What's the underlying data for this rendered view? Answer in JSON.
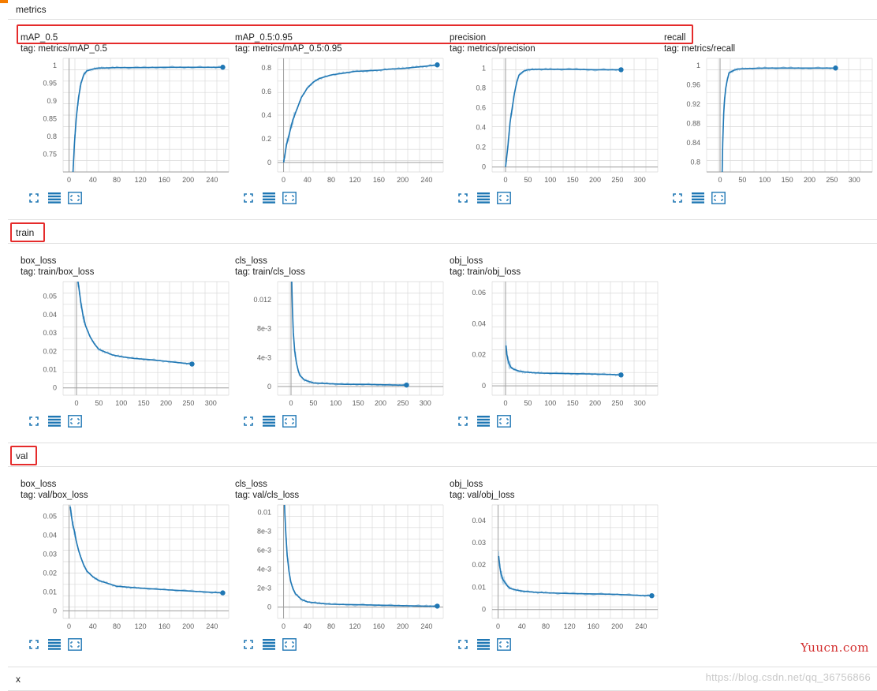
{
  "colors": {
    "topbar": "#f57c00",
    "line": "#1f77b4",
    "line_raw": "#b4d2e6",
    "highlight": "#e52b2b",
    "grid": "#d9d9d9"
  },
  "sections": [
    {
      "id": "metrics",
      "title": "metrics",
      "charts": [
        {
          "title": "mAP_0.5",
          "tag": "tag: metrics/mAP_0.5",
          "chart_data": {
            "type": "line",
            "title": "mAP_0.5",
            "xlim": [
              -10,
              268
            ],
            "ylim": [
              0.7,
              1.02
            ],
            "xticks": [
              0,
              40,
              80,
              120,
              160,
              200,
              240
            ],
            "yticks": [
              0.75,
              0.8,
              0.85,
              0.9,
              0.95,
              1
            ],
            "ytick_labels": [
              "0.75",
              "0.8",
              "0.85",
              "0.9",
              "0.95",
              "1"
            ],
            "series": [
              {
                "x": [
                  6,
                  9,
                  12,
                  16,
                  20,
                  25,
                  30,
                  40,
                  50,
                  60,
                  80,
                  120,
                  160,
                  200,
                  240,
                  258
                ],
                "y": [
                  0.68,
                  0.78,
                  0.85,
                  0.91,
                  0.95,
                  0.975,
                  0.985,
                  0.99,
                  0.993,
                  0.993,
                  0.994,
                  0.994,
                  0.995,
                  0.995,
                  0.995,
                  0.995
                ]
              }
            ]
          }
        },
        {
          "title": "mAP_0.5:0.95",
          "tag": "tag: metrics/mAP_0.5:0.95",
          "chart_data": {
            "type": "line",
            "title": "mAP_0.5:0.95",
            "xlim": [
              -10,
              268
            ],
            "ylim": [
              -0.08,
              0.88
            ],
            "xticks": [
              0,
              40,
              80,
              120,
              160,
              200,
              240
            ],
            "yticks": [
              0,
              0.2,
              0.4,
              0.6,
              0.8
            ],
            "ytick_labels": [
              "0",
              "0.2",
              "0.4",
              "0.6",
              "0.8"
            ],
            "series": [
              {
                "x": [
                  0,
                  5,
                  10,
                  15,
                  20,
                  30,
                  40,
                  50,
                  60,
                  80,
                  100,
                  120,
                  140,
                  160,
                  180,
                  200,
                  220,
                  240,
                  258
                ],
                "y": [
                  0,
                  0.15,
                  0.25,
                  0.35,
                  0.42,
                  0.55,
                  0.63,
                  0.68,
                  0.71,
                  0.74,
                  0.755,
                  0.77,
                  0.775,
                  0.78,
                  0.79,
                  0.795,
                  0.805,
                  0.815,
                  0.825
                ]
              }
            ]
          }
        },
        {
          "title": "precision",
          "tag": "tag: metrics/precision",
          "chart_data": {
            "type": "line",
            "title": "precision",
            "xlim": [
              -30,
              340
            ],
            "ylim": [
              -0.05,
              1.1
            ],
            "xticks": [
              0,
              50,
              100,
              150,
              200,
              250,
              300
            ],
            "yticks": [
              0,
              0.2,
              0.4,
              0.6,
              0.8,
              1
            ],
            "ytick_labels": [
              "0",
              "0.2",
              "0.4",
              "0.6",
              "0.8",
              "1"
            ],
            "series": [
              {
                "x": [
                  0,
                  5,
                  10,
                  15,
                  20,
                  25,
                  30,
                  40,
                  50,
                  70,
                  100,
                  150,
                  200,
                  258
                ],
                "y": [
                  0,
                  0.2,
                  0.45,
                  0.6,
                  0.75,
                  0.86,
                  0.93,
                  0.97,
                  0.985,
                  0.99,
                  0.99,
                  0.99,
                  0.985,
                  0.985
                ]
              }
            ]
          }
        },
        {
          "title": "recall",
          "tag": "tag: metrics/recall",
          "chart_data": {
            "type": "line",
            "title": "recall",
            "xlim": [
              -30,
              340
            ],
            "ylim": [
              0.78,
              1.015
            ],
            "xticks": [
              0,
              50,
              100,
              150,
              200,
              250,
              300
            ],
            "yticks": [
              0.8,
              0.84,
              0.88,
              0.92,
              0.96,
              1
            ],
            "ytick_labels": [
              "0.8",
              "0.84",
              "0.88",
              "0.92",
              "0.96",
              "1"
            ],
            "series": [
              {
                "x": [
                  4,
                  6,
                  8,
                  10,
                  13,
                  16,
                  20,
                  30,
                  40,
                  60,
                  100,
                  150,
                  200,
                  258
                ],
                "y": [
                  0.75,
                  0.84,
                  0.9,
                  0.93,
                  0.955,
                  0.97,
                  0.985,
                  0.99,
                  0.993,
                  0.994,
                  0.995,
                  0.995,
                  0.995,
                  0.995
                ]
              }
            ]
          }
        }
      ]
    },
    {
      "id": "train",
      "title": "train",
      "charts": [
        {
          "title": "box_loss",
          "tag": "tag: train/box_loss",
          "chart_data": {
            "type": "line",
            "title": "box_loss",
            "xlim": [
              -30,
              340
            ],
            "ylim": [
              -0.004,
              0.058
            ],
            "xticks": [
              0,
              50,
              100,
              150,
              200,
              250,
              300
            ],
            "yticks": [
              0,
              0.01,
              0.02,
              0.03,
              0.04,
              0.05
            ],
            "ytick_labels": [
              "0",
              "0.01",
              "0.02",
              "0.03",
              "0.04",
              "0.05"
            ],
            "series": [
              {
                "x": [
                  2,
                  5,
                  10,
                  15,
                  20,
                  30,
                  40,
                  50,
                  60,
                  80,
                  100,
                  130,
                  160,
                  200,
                  240,
                  258
                ],
                "y": [
                  0.06,
                  0.055,
                  0.046,
                  0.039,
                  0.034,
                  0.028,
                  0.024,
                  0.021,
                  0.02,
                  0.018,
                  0.017,
                  0.016,
                  0.0155,
                  0.0145,
                  0.0135,
                  0.013
                ]
              }
            ]
          }
        },
        {
          "title": "cls_loss",
          "tag": "tag: train/cls_loss",
          "chart_data": {
            "type": "line",
            "title": "cls_loss",
            "xlim": [
              -30,
              340
            ],
            "ylim": [
              -0.0012,
              0.0145
            ],
            "xticks": [
              0,
              50,
              100,
              150,
              200,
              250,
              300
            ],
            "yticks": [
              0,
              0.004,
              0.008,
              0.012
            ],
            "ytick_labels": [
              "0",
              "4e-3",
              "8e-3",
              "0.012"
            ],
            "series": [
              {
                "x": [
                  1,
                  3,
                  5,
                  8,
                  12,
                  16,
                  20,
                  30,
                  40,
                  50,
                  80,
                  120,
                  160,
                  200,
                  240,
                  258
                ],
                "y": [
                  0.016,
                  0.011,
                  0.0075,
                  0.005,
                  0.0033,
                  0.0022,
                  0.0015,
                  0.0009,
                  0.0007,
                  0.0005,
                  0.0004,
                  0.0003,
                  0.0003,
                  0.00025,
                  0.0002,
                  0.0002
                ]
              }
            ]
          }
        },
        {
          "title": "obj_loss",
          "tag": "tag: train/obj_loss",
          "chart_data": {
            "type": "line",
            "title": "obj_loss",
            "xlim": [
              -30,
              340
            ],
            "ylim": [
              -0.006,
              0.067
            ],
            "xticks": [
              0,
              50,
              100,
              150,
              200,
              250,
              300
            ],
            "yticks": [
              0,
              0.02,
              0.04,
              0.06
            ],
            "ytick_labels": [
              "0",
              "0.02",
              "0.04",
              "0.06"
            ],
            "series": [
              {
                "x": [
                  1,
                  3,
                  5,
                  8,
                  12,
                  16,
                  20,
                  30,
                  40,
                  60,
                  80,
                  120,
                  160,
                  200,
                  240,
                  258
                ],
                "y": [
                  0.026,
                  0.02,
                  0.017,
                  0.014,
                  0.012,
                  0.011,
                  0.0105,
                  0.0095,
                  0.009,
                  0.0085,
                  0.0082,
                  0.008,
                  0.0078,
                  0.0076,
                  0.0073,
                  0.007
                ]
              }
            ]
          }
        }
      ]
    },
    {
      "id": "val",
      "title": "val",
      "charts": [
        {
          "title": "box_loss",
          "tag": "tag: val/box_loss",
          "chart_data": {
            "type": "line",
            "title": "box_loss",
            "xlim": [
              -10,
              268
            ],
            "ylim": [
              -0.004,
              0.056
            ],
            "xticks": [
              0,
              40,
              80,
              120,
              160,
              200,
              240
            ],
            "yticks": [
              0,
              0.01,
              0.02,
              0.03,
              0.04,
              0.05
            ],
            "ytick_labels": [
              "0",
              "0.01",
              "0.02",
              "0.03",
              "0.04",
              "0.05"
            ],
            "series": [
              {
                "x": [
                  2,
                  4,
                  6,
                  9,
                  12,
                  16,
                  20,
                  25,
                  30,
                  40,
                  50,
                  60,
                  80,
                  100,
                  120,
                  160,
                  200,
                  240,
                  258
                ],
                "y": [
                  0.055,
                  0.05,
                  0.046,
                  0.042,
                  0.037,
                  0.032,
                  0.028,
                  0.024,
                  0.021,
                  0.018,
                  0.016,
                  0.015,
                  0.013,
                  0.0125,
                  0.012,
                  0.0112,
                  0.0105,
                  0.0098,
                  0.0095
                ]
              }
            ]
          }
        },
        {
          "title": "cls_loss",
          "tag": "tag: val/cls_loss",
          "chart_data": {
            "type": "line",
            "title": "cls_loss",
            "xlim": [
              -10,
              268
            ],
            "ylim": [
              -0.0012,
              0.0108
            ],
            "xticks": [
              0,
              40,
              80,
              120,
              160,
              200,
              240
            ],
            "yticks": [
              0,
              0.002,
              0.004,
              0.006,
              0.008,
              0.01
            ],
            "ytick_labels": [
              "0",
              "2e-3",
              "4e-3",
              "6e-3",
              "8e-3",
              "0.01"
            ],
            "series": [
              {
                "x": [
                  1,
                  2,
                  4,
                  6,
                  9,
                  12,
                  16,
                  20,
                  30,
                  40,
                  60,
                  80,
                  120,
                  160,
                  200,
                  240,
                  258
                ],
                "y": [
                  0.012,
                  0.01,
                  0.0075,
                  0.0055,
                  0.0038,
                  0.0027,
                  0.0019,
                  0.0014,
                  0.0008,
                  0.00055,
                  0.0004,
                  0.0003,
                  0.00025,
                  0.0002,
                  0.00015,
                  0.0001,
                  0.0001
                ]
              }
            ]
          }
        },
        {
          "title": "obj_loss",
          "tag": "tag: val/obj_loss",
          "chart_data": {
            "type": "line",
            "title": "obj_loss",
            "xlim": [
              -10,
              268
            ],
            "ylim": [
              -0.004,
              0.047
            ],
            "xticks": [
              0,
              40,
              80,
              120,
              160,
              200,
              240
            ],
            "yticks": [
              0,
              0.01,
              0.02,
              0.03,
              0.04
            ],
            "ytick_labels": [
              "0",
              "0.01",
              "0.02",
              "0.03",
              "0.04"
            ],
            "series": [
              {
                "x": [
                  1,
                  3,
                  5,
                  8,
                  12,
                  16,
                  20,
                  30,
                  40,
                  60,
                  80,
                  120,
                  160,
                  200,
                  240,
                  258
                ],
                "y": [
                  0.024,
                  0.019,
                  0.016,
                  0.0135,
                  0.012,
                  0.0105,
                  0.0095,
                  0.0088,
                  0.0083,
                  0.0078,
                  0.0075,
                  0.0072,
                  0.007,
                  0.0068,
                  0.0063,
                  0.0062
                ]
              }
            ]
          }
        }
      ]
    }
  ],
  "collapsed_section": {
    "title": "x"
  },
  "watermarks": {
    "site": "Yuucn.com",
    "source": "https://blog.csdn.net/qq_36756866"
  },
  "tool_icons": [
    "fit-to-screen-icon",
    "toggle-y-log-icon",
    "fit-domain-icon"
  ]
}
